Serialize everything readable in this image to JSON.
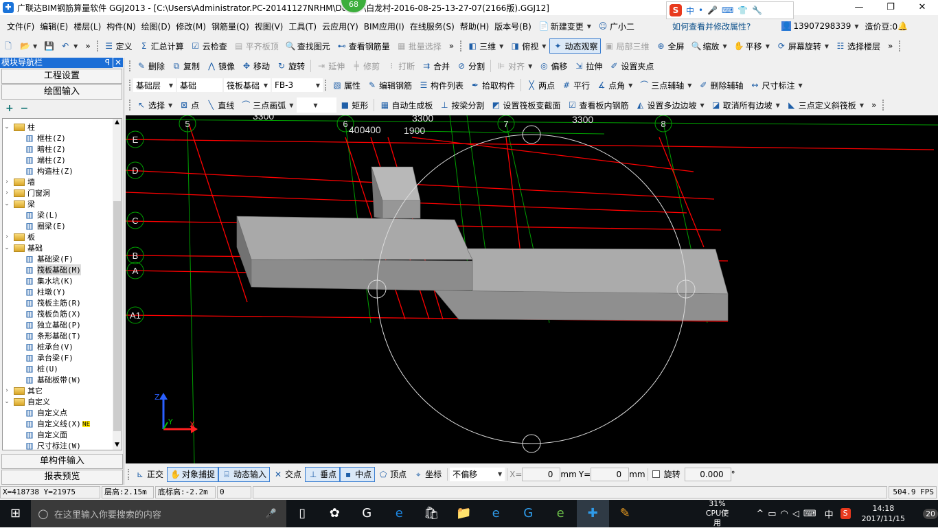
{
  "title": {
    "app_title": "广联达BIM钢筋算量软件 GGJ2013 - [C:\\Users\\Administrator.PC-20141127NRHM\\De",
    "file_part": "\\白龙村-2016-08-25-13-27-07(2166版).GGJ12]",
    "badge": "68",
    "minimize": "—",
    "restore": "❐",
    "close": "✕"
  },
  "ime": {
    "logo": "S",
    "items": [
      "中",
      "•",
      "🎤",
      "⌨",
      "👕",
      "🔧"
    ]
  },
  "menu": {
    "items": [
      "文件(F)",
      "编辑(E)",
      "楼层(L)",
      "构件(N)",
      "绘图(D)",
      "修改(M)",
      "钢筋量(Q)",
      "视图(V)",
      "工具(T)",
      "云应用(Y)",
      "BIM应用(I)",
      "在线服务(S)",
      "帮助(H)",
      "版本号(B)"
    ],
    "new_change": "新建变更",
    "assistant": "广小二",
    "help_link": "如何查看并修改属性?",
    "user": "13907298339",
    "beans": "造价豆:0"
  },
  "toolbar1": [
    {
      "icon": "new",
      "label": ""
    },
    {
      "icon": "open",
      "label": "",
      "dd": true
    },
    {
      "icon": "save",
      "label": ""
    },
    {
      "icon": "undo",
      "label": "",
      "dd": true
    },
    {
      "icon": "more",
      "label": "»"
    },
    {
      "icon": "define",
      "label": "定义"
    },
    {
      "icon": "sigma",
      "label": "汇总计算"
    },
    {
      "icon": "cloud-check",
      "label": "云检查"
    },
    {
      "icon": "align-top",
      "label": "平齐板顶",
      "dis": true
    },
    {
      "icon": "find",
      "label": "查找图元"
    },
    {
      "icon": "view-rebar",
      "label": "查看钢筋量"
    },
    {
      "icon": "batch",
      "label": "批量选择",
      "dis": true
    },
    {
      "icon": "more",
      "label": "»"
    },
    {
      "icon": "3d",
      "label": "三维",
      "dd": true
    },
    {
      "icon": "top-view",
      "label": "俯视",
      "dd": true
    },
    {
      "icon": "orbit",
      "label": "动态观察",
      "on": true
    },
    {
      "icon": "partial-3d",
      "label": "局部三维",
      "dis": true
    },
    {
      "icon": "fullscreen",
      "label": "全屏"
    },
    {
      "icon": "zoom",
      "label": "缩放",
      "dd": true
    },
    {
      "icon": "pan",
      "label": "平移",
      "dd": true
    },
    {
      "icon": "rotate-screen",
      "label": "屏幕旋转",
      "dd": true
    },
    {
      "icon": "select-floor",
      "label": "选择楼层"
    },
    {
      "icon": "more",
      "label": "»"
    }
  ],
  "toolbar2": [
    {
      "icon": "delete",
      "label": "删除"
    },
    {
      "icon": "copy",
      "label": "复制"
    },
    {
      "icon": "mirror",
      "label": "镜像"
    },
    {
      "icon": "move",
      "label": "移动"
    },
    {
      "icon": "rotate",
      "label": "旋转"
    },
    {
      "icon": "extend",
      "label": "延伸",
      "dis": true
    },
    {
      "icon": "trim",
      "label": "修剪",
      "dis": true
    },
    {
      "icon": "break",
      "label": "打断",
      "dis": true
    },
    {
      "icon": "merge",
      "label": "合并"
    },
    {
      "icon": "split",
      "label": "分割"
    },
    {
      "icon": "align",
      "label": "对齐",
      "dis": true,
      "dd": true
    },
    {
      "icon": "offset",
      "label": "偏移"
    },
    {
      "icon": "stretch",
      "label": "拉伸"
    },
    {
      "icon": "grip-point",
      "label": "设置夹点"
    }
  ],
  "toolbar3": {
    "selects": [
      "基础层",
      "基础",
      "筏板基础",
      "FB-3"
    ],
    "items": [
      {
        "icon": "properties",
        "label": "属性"
      },
      {
        "icon": "edit-rebar",
        "label": "编辑钢筋"
      },
      {
        "icon": "list",
        "label": "构件列表"
      },
      {
        "icon": "pick",
        "label": "拾取构件"
      },
      {
        "icon": "two-point",
        "label": "两点"
      },
      {
        "icon": "parallel",
        "label": "平行"
      },
      {
        "icon": "point-angle",
        "label": "点角",
        "dd": true
      },
      {
        "icon": "three-point-axis",
        "label": "三点辅轴",
        "dd": true
      },
      {
        "icon": "delete-axis",
        "label": "删除辅轴"
      },
      {
        "icon": "dimension",
        "label": "尺寸标注",
        "dd": true
      }
    ]
  },
  "toolbar4": [
    {
      "icon": "cursor",
      "label": "选择",
      "dd": true
    },
    {
      "icon": "point",
      "label": "点"
    },
    {
      "icon": "line",
      "label": "直线"
    },
    {
      "icon": "arc",
      "label": "三点画弧",
      "dd": true
    },
    {
      "icon": "blank-select",
      "label": "",
      "dd": true
    },
    {
      "icon": "rect",
      "label": "矩形"
    },
    {
      "icon": "auto-slab",
      "label": "自动生成板"
    },
    {
      "icon": "beam-split",
      "label": "按梁分割"
    },
    {
      "icon": "section",
      "label": "设置筏板变截面"
    },
    {
      "icon": "view-slab-rebar",
      "label": "查看板内钢筋"
    },
    {
      "icon": "multi-slope",
      "label": "设置多边边坡",
      "dd": true
    },
    {
      "icon": "cancel-slope",
      "label": "取消所有边坡",
      "dd": true
    },
    {
      "icon": "three-point-slope",
      "label": "三点定义斜筏板",
      "dd": true
    },
    {
      "icon": "more",
      "label": "»"
    }
  ],
  "nav": {
    "title": "模块导航栏",
    "pin": "ꟼ",
    "close": "✕",
    "project_settings": "工程设置",
    "drawing_input": "绘图输入",
    "expand": "+",
    "collapse": "−",
    "single_input": "单构件输入",
    "report": "报表预览",
    "tree": [
      {
        "label": "柱",
        "lvl": 0,
        "open": true
      },
      {
        "label": "框柱(Z)",
        "lvl": 1
      },
      {
        "label": "暗柱(Z)",
        "lvl": 1
      },
      {
        "label": "端柱(Z)",
        "lvl": 1
      },
      {
        "label": "构造柱(Z)",
        "lvl": 1
      },
      {
        "label": "墙",
        "lvl": 0,
        "open": false
      },
      {
        "label": "门窗洞",
        "lvl": 0,
        "open": false
      },
      {
        "label": "梁",
        "lvl": 0,
        "open": true
      },
      {
        "label": "梁(L)",
        "lvl": 1
      },
      {
        "label": "圈梁(E)",
        "lvl": 1
      },
      {
        "label": "板",
        "lvl": 0,
        "open": false
      },
      {
        "label": "基础",
        "lvl": 0,
        "open": true
      },
      {
        "label": "基础梁(F)",
        "lvl": 1
      },
      {
        "label": "筏板基础(M)",
        "lvl": 1,
        "selected": true
      },
      {
        "label": "集水坑(K)",
        "lvl": 1
      },
      {
        "label": "柱墩(Y)",
        "lvl": 1
      },
      {
        "label": "筏板主筋(R)",
        "lvl": 1
      },
      {
        "label": "筏板负筋(X)",
        "lvl": 1
      },
      {
        "label": "独立基础(P)",
        "lvl": 1
      },
      {
        "label": "条形基础(T)",
        "lvl": 1
      },
      {
        "label": "桩承台(V)",
        "lvl": 1
      },
      {
        "label": "承台梁(F)",
        "lvl": 1
      },
      {
        "label": "桩(U)",
        "lvl": 1
      },
      {
        "label": "基础板带(W)",
        "lvl": 1
      },
      {
        "label": "其它",
        "lvl": 0,
        "open": false
      },
      {
        "label": "自定义",
        "lvl": 0,
        "open": true
      },
      {
        "label": "自定义点",
        "lvl": 1
      },
      {
        "label": "自定义线(X)",
        "lvl": 1,
        "new": "NE"
      },
      {
        "label": "自定义面",
        "lvl": 1
      },
      {
        "label": "尺寸标注(W)",
        "lvl": 1
      }
    ]
  },
  "canvas": {
    "row_axes": [
      "E",
      "D",
      "C",
      "B",
      "A",
      "A1"
    ],
    "col_axes": [
      "5",
      "6",
      "7",
      "8"
    ],
    "dims": [
      "3300",
      "3300",
      "3300",
      "400400",
      "1900"
    ],
    "coord_labels": {
      "z": "Z",
      "x": "X",
      "y": "Y"
    },
    "colors": {
      "background": "#000000",
      "axis": "#00a000",
      "slab_line": "#ff0000",
      "solid": "#a8a8a8"
    }
  },
  "bottombar": {
    "items": [
      {
        "icon": "ortho",
        "label": "正交"
      },
      {
        "icon": "snap",
        "label": "对象捕捉",
        "on": true
      },
      {
        "icon": "dynamic-input",
        "label": "动态输入",
        "on": true
      },
      {
        "icon": "intersection",
        "label": "交点"
      },
      {
        "icon": "perpendicular",
        "label": "垂点",
        "on": true
      },
      {
        "icon": "midpoint",
        "label": "中点",
        "on": true
      },
      {
        "icon": "vertex",
        "label": "顶点"
      },
      {
        "icon": "coordinate",
        "label": "坐标"
      }
    ],
    "offset_mode": "不偏移",
    "x_label": "X=",
    "x_value": "0",
    "y_label": "Y=",
    "y_value": "0",
    "unit": "mm",
    "rotate_label": "旋转",
    "rotate_value": "0.000",
    "degree": "°"
  },
  "status": {
    "coords": "X=418738 Y=21975",
    "floor_height": "层高:2.15m",
    "bottom_elev": "底标高:-2.2m",
    "value": "0",
    "fps": "504.9 FPS"
  },
  "taskbar": {
    "search_placeholder": "在这里输入你要搜索的内容",
    "cpu_percent": "31%",
    "cpu_label": "CPU使用",
    "time": "14:18",
    "date": "2017/11/15",
    "ime": "中",
    "notifications": "20"
  }
}
